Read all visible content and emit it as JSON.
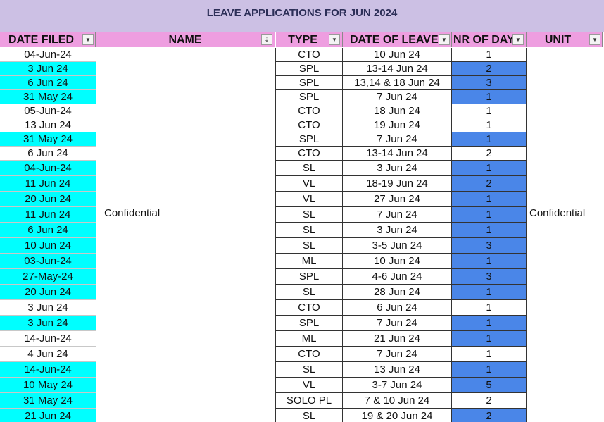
{
  "sheet": {
    "title": "LEAVE APPLICATIONS FOR JUN 2024",
    "headers": {
      "date_filed": "DATE FILED",
      "name": "NAME",
      "type": "TYPE",
      "date_of_leave": "DATE OF LEAVE",
      "nr_of_days": "NR OF DAYS",
      "unit": "UNIT"
    },
    "filter_icons": {
      "dropdown": "▼",
      "sort": "⇣"
    },
    "name_placeholder": "Confidential",
    "unit_placeholder": "Confidential",
    "colors": {
      "title_bg": "#ccc0e4",
      "header_bg": "#ee9ee0",
      "date_highlight": "#00ffff",
      "days_highlight": "#4a86e8"
    },
    "rows": [
      {
        "date_filed": "04-Jun-24",
        "type": "CTO",
        "date_of_leave": "10 Jun 24",
        "nr_of_days": "1",
        "date_hl": false,
        "days_hl": false
      },
      {
        "date_filed": "3 Jun 24",
        "type": "SPL",
        "date_of_leave": "13-14 Jun 24",
        "nr_of_days": "2",
        "date_hl": true,
        "days_hl": true
      },
      {
        "date_filed": "6 Jun 24",
        "type": "SPL",
        "date_of_leave": "13,14 & 18 Jun 24",
        "nr_of_days": "3",
        "date_hl": true,
        "days_hl": true
      },
      {
        "date_filed": "31 May 24",
        "type": "SPL",
        "date_of_leave": "7 Jun 24",
        "nr_of_days": "1",
        "date_hl": true,
        "days_hl": true
      },
      {
        "date_filed": "05-Jun-24",
        "type": "CTO",
        "date_of_leave": "18 Jun 24",
        "nr_of_days": "1",
        "date_hl": false,
        "days_hl": false
      },
      {
        "date_filed": "13 Jun 24",
        "type": "CTO",
        "date_of_leave": "19 Jun 24",
        "nr_of_days": "1",
        "date_hl": false,
        "days_hl": false
      },
      {
        "date_filed": "31 May 24",
        "type": "SPL",
        "date_of_leave": "7 Jun 24",
        "nr_of_days": "1",
        "date_hl": true,
        "days_hl": true
      },
      {
        "date_filed": "6 Jun 24",
        "type": "CTO",
        "date_of_leave": "13-14 Jun 24",
        "nr_of_days": "2",
        "date_hl": false,
        "days_hl": false
      },
      {
        "date_filed": "04-Jun-24",
        "type": "SL",
        "date_of_leave": "3 Jun 24",
        "nr_of_days": "1",
        "date_hl": true,
        "days_hl": true
      },
      {
        "date_filed": "11 Jun 24",
        "type": "VL",
        "date_of_leave": "18-19 Jun 24",
        "nr_of_days": "2",
        "date_hl": true,
        "days_hl": true
      },
      {
        "date_filed": "20 Jun 24",
        "type": "VL",
        "date_of_leave": "27 Jun 24",
        "nr_of_days": "1",
        "date_hl": true,
        "days_hl": true
      },
      {
        "date_filed": "11 Jun 24",
        "type": "SL",
        "date_of_leave": "7 Jun 24",
        "nr_of_days": "1",
        "date_hl": true,
        "days_hl": true
      },
      {
        "date_filed": "6 Jun 24",
        "type": "SL",
        "date_of_leave": "3 Jun 24",
        "nr_of_days": "1",
        "date_hl": true,
        "days_hl": true
      },
      {
        "date_filed": "10 Jun 24",
        "type": "SL",
        "date_of_leave": "3-5 Jun 24",
        "nr_of_days": "3",
        "date_hl": true,
        "days_hl": true
      },
      {
        "date_filed": "03-Jun-24",
        "type": "ML",
        "date_of_leave": "10 Jun 24",
        "nr_of_days": "1",
        "date_hl": true,
        "days_hl": true
      },
      {
        "date_filed": "27-May-24",
        "type": "SPL",
        "date_of_leave": "4-6 Jun 24",
        "nr_of_days": "3",
        "date_hl": true,
        "days_hl": true
      },
      {
        "date_filed": "20 Jun 24",
        "type": "SL",
        "date_of_leave": "28 Jun 24",
        "nr_of_days": "1",
        "date_hl": true,
        "days_hl": true
      },
      {
        "date_filed": "3 Jun 24",
        "type": "CTO",
        "date_of_leave": "6 Jun 24",
        "nr_of_days": "1",
        "date_hl": false,
        "days_hl": false
      },
      {
        "date_filed": "3 Jun 24",
        "type": "SPL",
        "date_of_leave": "7 Jun 24",
        "nr_of_days": "1",
        "date_hl": true,
        "days_hl": true
      },
      {
        "date_filed": "14-Jun-24",
        "type": "ML",
        "date_of_leave": "21 Jun 24",
        "nr_of_days": "1",
        "date_hl": false,
        "days_hl": true
      },
      {
        "date_filed": "4 Jun 24",
        "type": "CTO",
        "date_of_leave": "7 Jun 24",
        "nr_of_days": "1",
        "date_hl": false,
        "days_hl": false
      },
      {
        "date_filed": "14-Jun-24",
        "type": "SL",
        "date_of_leave": "13 Jun 24",
        "nr_of_days": "1",
        "date_hl": true,
        "days_hl": true
      },
      {
        "date_filed": "10 May 24",
        "type": "VL",
        "date_of_leave": "3-7 Jun 24",
        "nr_of_days": "5",
        "date_hl": true,
        "days_hl": true
      },
      {
        "date_filed": "31 May 24",
        "type": "SOLO PL",
        "date_of_leave": "7 & 10 Jun 24",
        "nr_of_days": "2",
        "date_hl": true,
        "days_hl": false
      },
      {
        "date_filed": "21 Jun 24",
        "type": "SL",
        "date_of_leave": "19 & 20 Jun 24",
        "nr_of_days": "2",
        "date_hl": true,
        "days_hl": true
      }
    ]
  }
}
